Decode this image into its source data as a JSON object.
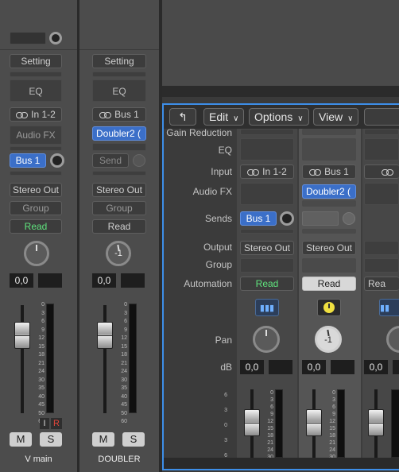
{
  "left_mixer": {
    "channels": [
      {
        "setting": "Setting",
        "eq": "EQ",
        "input": "In 1-2",
        "audio_fx": "Audio FX",
        "send": "Bus 1",
        "output": "Stereo Out",
        "group": "Group",
        "automation": "Read",
        "pan_value": "",
        "db_value": "0,0",
        "input_monitor": "I",
        "record_enable": "R",
        "mute": "M",
        "solo": "S",
        "name": "V main"
      },
      {
        "setting": "Setting",
        "eq": "EQ",
        "input": "Bus 1",
        "audio_fx": "Doubler2 (",
        "send": "Send",
        "output": "Stereo Out",
        "group": "Group",
        "automation": "Read",
        "pan_value": "-1",
        "db_value": "0,0",
        "mute": "M",
        "solo": "S",
        "name": "DOUBLER"
      }
    ],
    "fader_scale": [
      "0",
      "3",
      "6",
      "9",
      "12",
      "15",
      "18",
      "21",
      "24",
      "30",
      "35",
      "40",
      "45",
      "50",
      "60"
    ]
  },
  "mixer_window": {
    "toolbar": {
      "back_icon": "return-arrow-icon",
      "edit": "Edit",
      "options": "Options",
      "view": "View"
    },
    "row_labels": {
      "gain_reduction": "Gain Reduction",
      "eq": "EQ",
      "input": "Input",
      "audio_fx": "Audio FX",
      "sends": "Sends",
      "output": "Output",
      "group": "Group",
      "automation": "Automation",
      "pan": "Pan",
      "db": "dB"
    },
    "channels": [
      {
        "input": "In 1-2",
        "send": "Bus 1",
        "output": "Stereo Out",
        "automation": "Read",
        "icon": "audio-waveform-icon",
        "pan_value": "",
        "db_value": "0,0"
      },
      {
        "input": "Bus 1",
        "audio_fx": "Doubler2 (",
        "output": "Stereo Out",
        "automation": "Read",
        "icon": "aux-knob-icon",
        "pan_value": "-1",
        "db_value": "0,0"
      },
      {
        "automation": "Rea",
        "icon": "audio-waveform-icon",
        "db_value": "0,0"
      }
    ],
    "fader_scale": [
      "6",
      "3",
      "0",
      "3",
      "6",
      "10"
    ],
    "meter_scale": [
      "0",
      "3",
      "6",
      "9",
      "12",
      "15",
      "18",
      "21",
      "24",
      "30"
    ]
  }
}
